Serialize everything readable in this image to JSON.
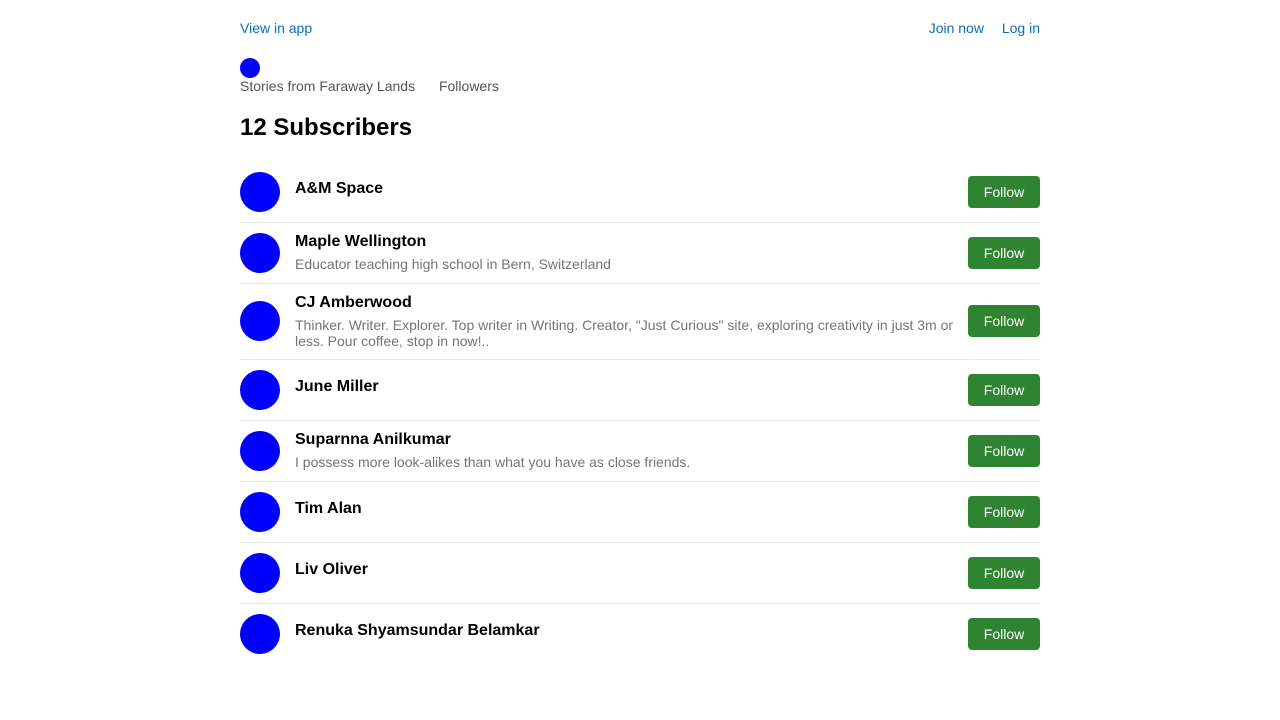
{
  "colors": {
    "link": "#0a6ebd",
    "avatar": "#0000ff",
    "follow_button": "#2e8431",
    "bio_text": "#757575"
  },
  "topbar": {
    "view_in_app": "View in app",
    "join_now": "Join now",
    "log_in": "Log in"
  },
  "breadcrumb": {
    "publication": "Stories from Faraway Lands",
    "section": "Followers"
  },
  "heading": "12 Subscribers",
  "subscribers": [
    {
      "name": "A&M Space",
      "bio": "",
      "follow_label": "Follow"
    },
    {
      "name": "Maple Wellington",
      "bio": "Educator teaching high school in Bern, Switzerland",
      "follow_label": "Follow"
    },
    {
      "name": "CJ Amberwood",
      "bio": "Thinker. Writer. Explorer. Top writer in Writing. Creator, \"Just Curious\" site, exploring creativity in just 3m or less. Pour coffee, stop in now!..",
      "follow_label": "Follow"
    },
    {
      "name": "June Miller",
      "bio": "",
      "follow_label": "Follow"
    },
    {
      "name": "Suparnna Anilkumar",
      "bio": "I possess more look-alikes than what you have as close friends.",
      "follow_label": "Follow"
    },
    {
      "name": "Tim Alan",
      "bio": "",
      "follow_label": "Follow"
    },
    {
      "name": "Liv Oliver",
      "bio": "",
      "follow_label": "Follow"
    },
    {
      "name": "Renuka Shyamsundar Belamkar",
      "bio": "",
      "follow_label": "Follow"
    }
  ]
}
